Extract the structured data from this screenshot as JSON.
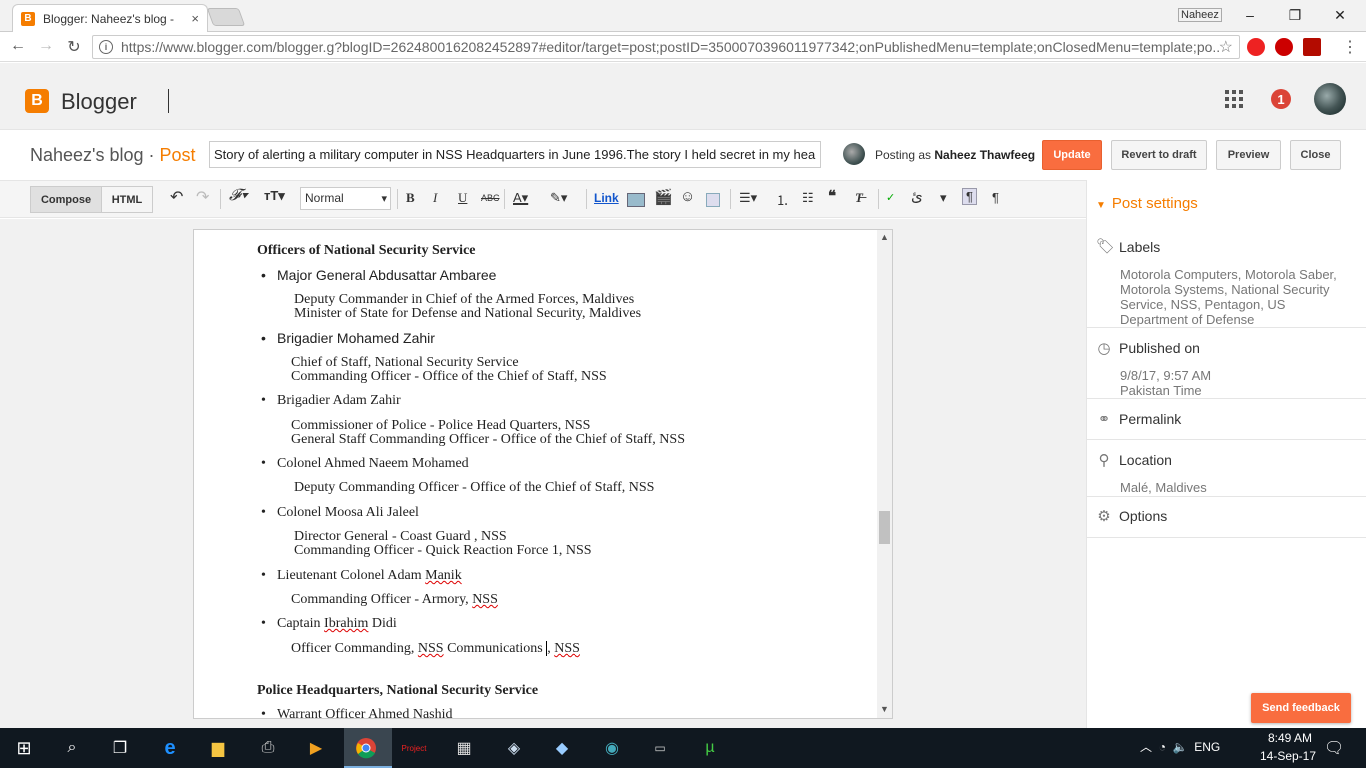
{
  "browser": {
    "tab_title": "Blogger: Naheez's blog -",
    "tab_close": "×",
    "window_user": "Naheez",
    "window_buttons": [
      "–",
      "❐",
      "✕"
    ],
    "url": "https://www.blogger.com/blogger.g?blogID=2624800162082452897#editor/target=post;postID=3500070396011977342;onPublishedMenu=template;onClosedMenu=template;po...",
    "nav": {
      "back": "←",
      "forward": "→",
      "reload": "↻"
    },
    "star": "☆",
    "menu": "⋮"
  },
  "header": {
    "logo_letter": "B",
    "brand": "Blogger",
    "notification_count": "1"
  },
  "postbar": {
    "blog_name": "Naheez's blog",
    "separator": " · ",
    "section": "Post",
    "title_value": "Story of alerting a military computer in NSS Headquarters in June 1996.The story I held secret in my hear",
    "posting_as_prefix": "Posting as ",
    "posting_as_name": "Naheez Thawfeeg",
    "buttons": {
      "update": "Update",
      "revert": "Revert to draft",
      "preview": "Preview",
      "close": "Close"
    }
  },
  "toolbar": {
    "compose": "Compose",
    "html": "HTML",
    "format_value": "Normal",
    "link": "Link"
  },
  "editor": {
    "heading1": "Officers of National Security Service",
    "items": [
      {
        "name": "Major General Abdusattar Ambaree",
        "lines": [
          "Deputy Commander in Chief of the Armed Forces, Maldives",
          "Minister of State for Defense and National Security, Maldives"
        ]
      },
      {
        "name": "Brigadier Mohamed Zahir",
        "lines": [
          "Chief of Staff, National Security Service",
          "Commanding Officer - Office of the Chief of Staff, NSS"
        ]
      },
      {
        "name": "Brigadier Adam Zahir",
        "lines": [
          "Commissioner of Police - Police Head Quarters, NSS",
          "General Staff Commanding Officer - Office of the Chief of Staff, NSS"
        ]
      },
      {
        "name": "Colonel Ahmed Naeem Mohamed",
        "lines": [
          "Deputy Commanding Officer - Office of the Chief of Staff, NSS"
        ]
      },
      {
        "name": "Colonel Moosa Ali Jaleel",
        "lines": [
          "Director General - Coast Guard , NSS",
          "Commanding Officer - Quick Reaction Force 1, NSS"
        ]
      },
      {
        "name_prefix": "Lieutenant Colonel Adam ",
        "name_squig": "Manik",
        "lines_prefix": "Commanding Officer - Armory, ",
        "lines_squig": "NSS"
      },
      {
        "name_prefix": "Captain ",
        "name_squig": "Ibrahim",
        "name_suffix": " Didi",
        "line_prefix": "Officer Commanding, ",
        "line_squig1": "NSS",
        "line_mid": " Communications ",
        "line_sep": ", ",
        "line_squig2": "NSS"
      }
    ],
    "heading2": "Police Headquarters, National Security Service",
    "item_last": "Warrant Officer Ahmed Nashid"
  },
  "sidebar": {
    "title": "Post settings",
    "labels_title": "Labels",
    "labels_value": "Motorola Computers, Motorola Saber, Motorola Systems, National Security Service, NSS, Pentagon, US Department of Defense",
    "published_title": "Published on",
    "published_value_line1": "9/8/17, 9:57 AM",
    "published_value_line2": "Pakistan Time",
    "permalink_title": "Permalink",
    "location_title": "Location",
    "location_value": "Malé, Maldives",
    "options_title": "Options"
  },
  "feedback": "Send feedback",
  "taskbar": {
    "language": "ENG",
    "time": "8:49 AM",
    "date": "14-Sep-17"
  },
  "colors": {
    "accent": "#f57d00",
    "update_button": "#f96d3f",
    "taskbar": "#101820"
  }
}
